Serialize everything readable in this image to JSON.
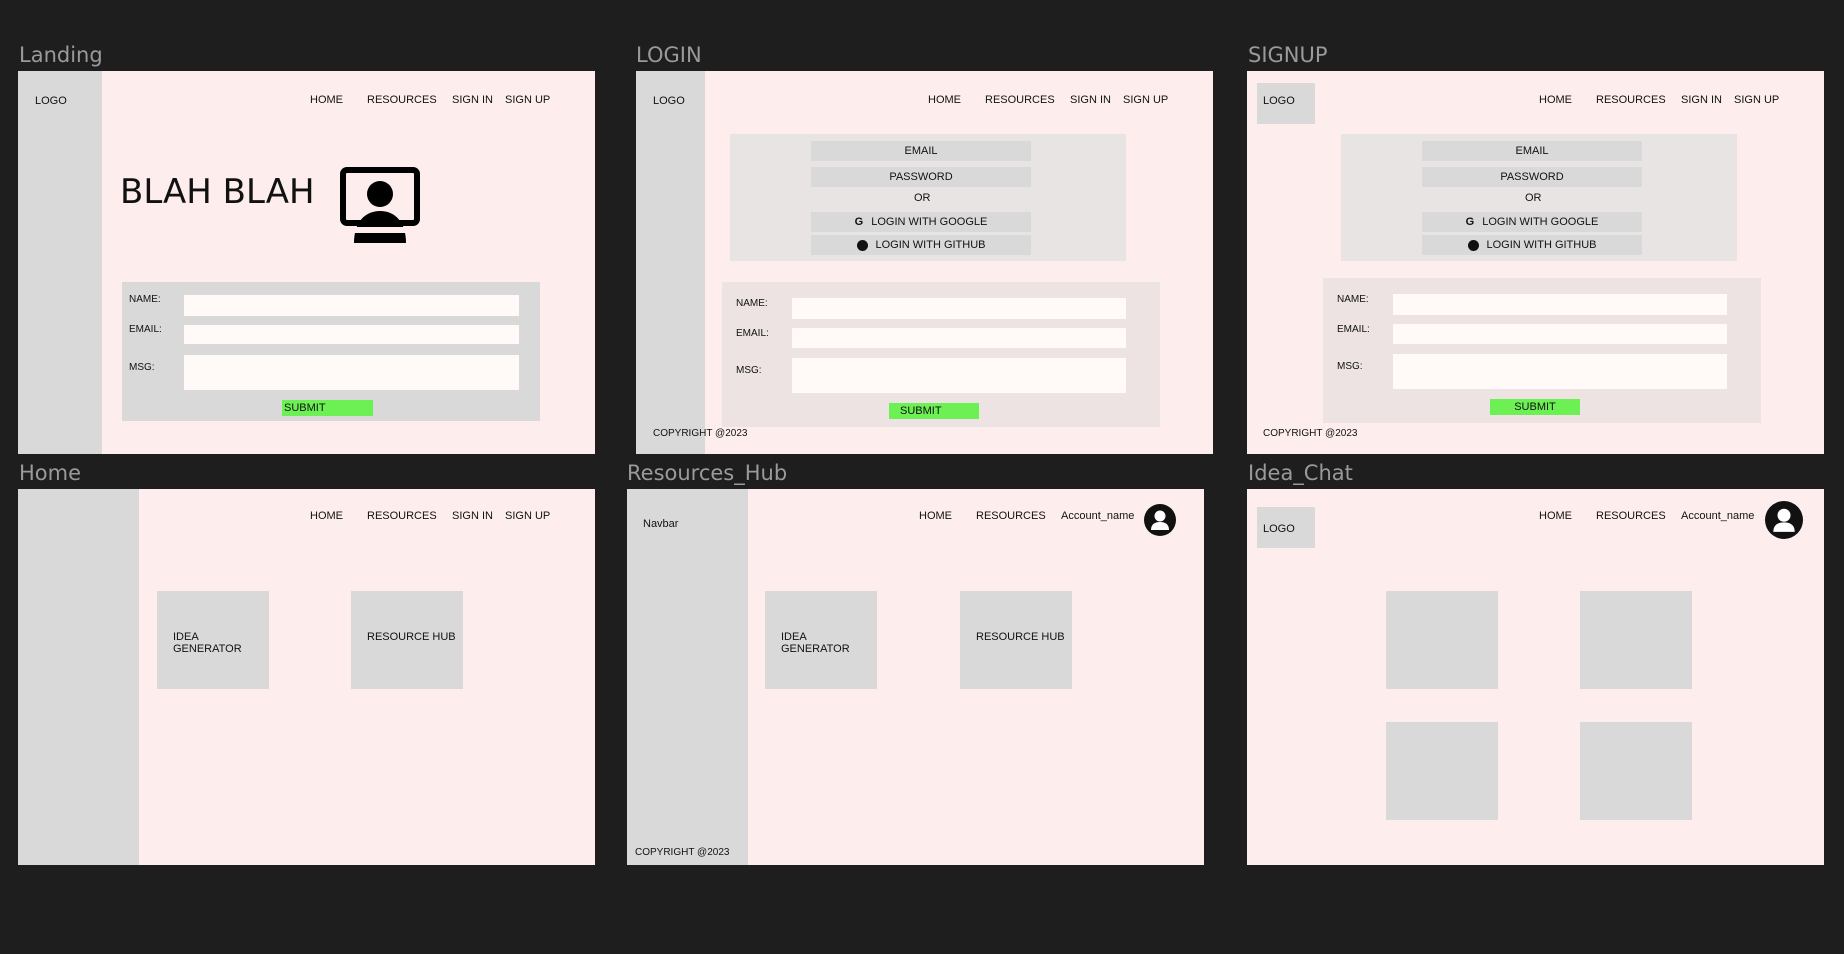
{
  "frames": {
    "landing": {
      "title": "Landing",
      "logo": "LOGO",
      "nav": [
        "HOME",
        "RESOURCES",
        "SIGN IN",
        "SIGN UP"
      ],
      "hero_text": "BLAH BLAH",
      "hero_icon": "person-at-monitor-icon",
      "form": {
        "name_label": "NAME:",
        "email_label": "EMAIL:",
        "msg_label": "MSG:",
        "submit": "SUBMIT"
      }
    },
    "login": {
      "title": "LOGIN",
      "logo": "LOGO",
      "nav": [
        "HOME",
        "RESOURCES",
        "SIGN IN",
        "SIGN UP"
      ],
      "auth": {
        "email": "EMAIL",
        "password": "PASSWORD",
        "or": "OR",
        "google": "LOGIN WITH GOOGLE",
        "github": "LOGIN WITH GITHUB"
      },
      "form": {
        "name_label": "NAME:",
        "email_label": "EMAIL:",
        "msg_label": "MSG:",
        "submit": "SUBMIT"
      },
      "copyright": "COPYRIGHT @2023"
    },
    "signup": {
      "title": "SIGNUP",
      "logo": "LOGO",
      "nav": [
        "HOME",
        "RESOURCES",
        "SIGN IN",
        "SIGN UP"
      ],
      "auth": {
        "email": "EMAIL",
        "password": "PASSWORD",
        "or": "OR",
        "google": "LOGIN WITH GOOGLE",
        "github": "LOGIN WITH GITHUB"
      },
      "form": {
        "name_label": "NAME:",
        "email_label": "EMAIL:",
        "msg_label": "MSG:",
        "submit": "SUBMIT"
      },
      "copyright": "COPYRIGHT @2023"
    },
    "home": {
      "title": "Home",
      "nav": [
        "HOME",
        "RESOURCES",
        "SIGN IN",
        "SIGN UP"
      ],
      "cards": [
        "IDEA\nGENERATOR",
        "RESOURCE HUB"
      ]
    },
    "resources_hub": {
      "title": "Resources_Hub",
      "sidebar_label": "Navbar",
      "nav": [
        "HOME",
        "RESOURCES",
        "Account_name"
      ],
      "cards": [
        "IDEA\nGENERATOR",
        "RESOURCE HUB"
      ],
      "copyright": "COPYRIGHT @2023"
    },
    "idea_chat": {
      "title": "Idea_Chat",
      "logo": "LOGO",
      "nav": [
        "HOME",
        "RESOURCES",
        "Account_name"
      ]
    }
  },
  "colors": {
    "canvas": "#1e1e1e",
    "frame_bg": "#fdeeed",
    "sidebar": "#d9d9d9",
    "submit": "#6cf054",
    "title": "#9a9a9a"
  }
}
